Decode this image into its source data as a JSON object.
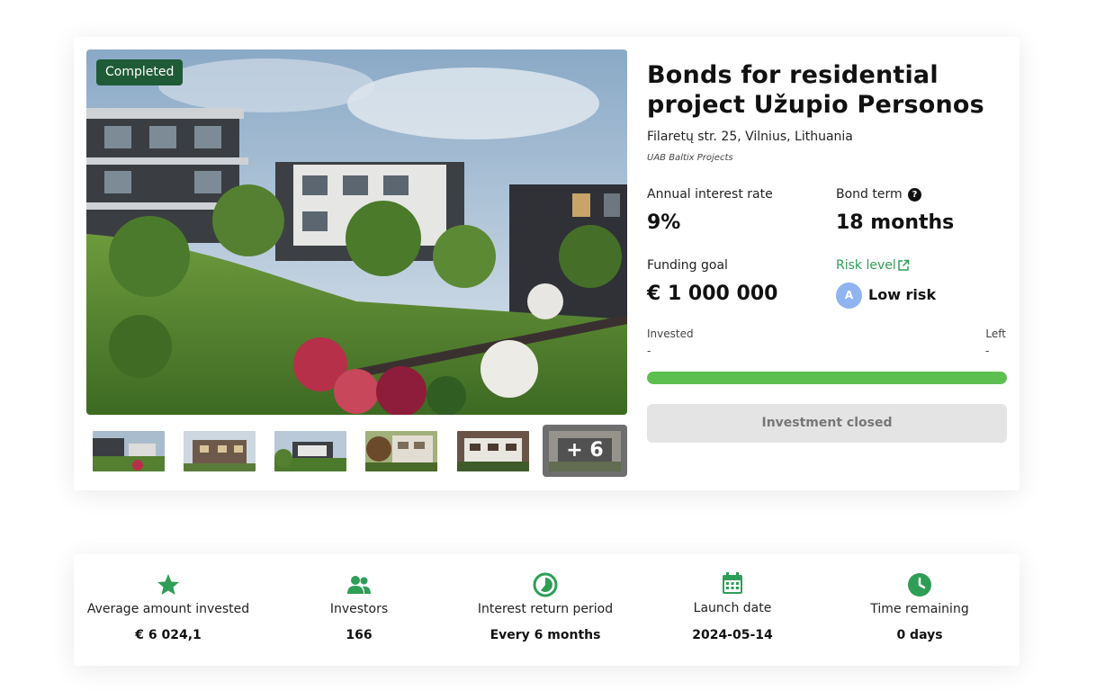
{
  "status_badge": "Completed",
  "project": {
    "title": "Bonds for residential project Užupio Personos",
    "address": "Filaretų str. 25, Vilnius, Lithuania",
    "company": "UAB Baltix Projects"
  },
  "metrics": {
    "interest_label": "Annual interest rate",
    "interest_value": "9%",
    "term_label": "Bond term",
    "term_help_icon": "question-circle-icon",
    "term_value": "18 months",
    "goal_label": "Funding goal",
    "goal_value": "€ 1 000 000",
    "risk_label": "Risk level",
    "risk_link_icon": "external-link-icon",
    "risk_grade": "A",
    "risk_value": "Low risk"
  },
  "funding": {
    "invested_label": "Invested",
    "invested_value": "-",
    "left_label": "Left",
    "left_value": "-",
    "progress_fraction": 1.0
  },
  "action_button": "Investment closed",
  "gallery": {
    "more_label": "+ 6"
  },
  "stats": [
    {
      "icon": "star-icon",
      "label": "Average amount invested",
      "value": "€ 6 024,1"
    },
    {
      "icon": "users-icon",
      "label": "Investors",
      "value": "166"
    },
    {
      "icon": "clock-cycle-icon",
      "label": "Interest return period",
      "value": "Every 6 months"
    },
    {
      "icon": "calendar-icon",
      "label": "Launch date",
      "value": "2024-05-14"
    },
    {
      "icon": "clock-icon",
      "label": "Time remaining",
      "value": "0 days"
    }
  ],
  "colors": {
    "accent_green": "#2e9e57",
    "progress_green": "#5cbf4f",
    "badge_green": "#1f5b36",
    "risk_avatar": "#8fb4ef",
    "button_disabled": "#e4e4e4"
  }
}
